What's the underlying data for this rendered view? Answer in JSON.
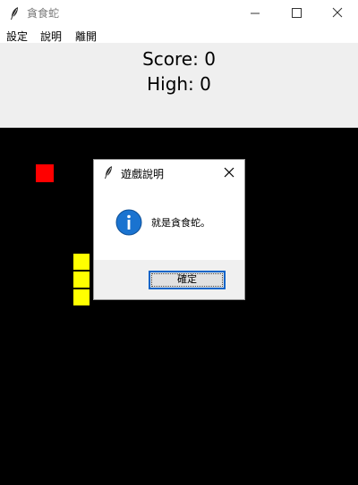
{
  "window": {
    "title": "貪食蛇",
    "icon": "feather-icon"
  },
  "menu": {
    "items": [
      {
        "label": "設定"
      },
      {
        "label": "說明"
      },
      {
        "label": "離開"
      }
    ]
  },
  "score_panel": {
    "score_text": "Score: 0",
    "high_text": "High: 0"
  },
  "game": {
    "food_color": "#ff0000",
    "snake_color": "#ffff00",
    "snake_length": 3
  },
  "dialog": {
    "title": "遊戲說明",
    "icon": "info-icon",
    "message": "就是貪食蛇。",
    "ok_label": "確定",
    "accent": "#0a64c8"
  }
}
